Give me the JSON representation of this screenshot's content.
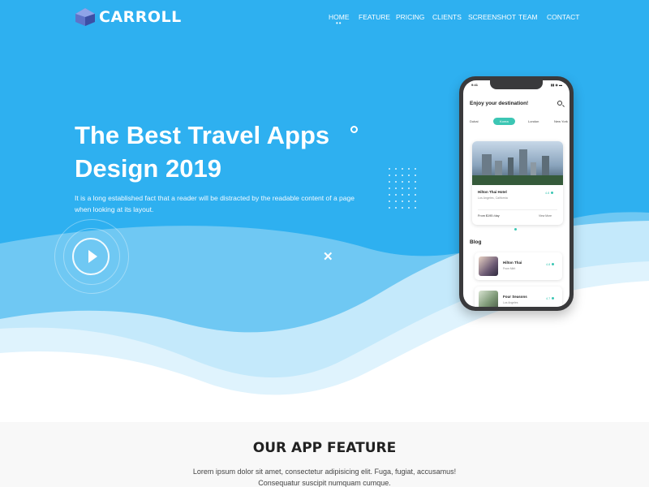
{
  "brand": {
    "name": "CARROLL",
    "accent": "#2eb0f0"
  },
  "nav": {
    "items": [
      {
        "label": "HOME"
      },
      {
        "label": "FEATURE"
      },
      {
        "label": "PRICING"
      },
      {
        "label": "CLIENTS"
      },
      {
        "label": "SCREENSHOT"
      },
      {
        "label": "TEAM"
      },
      {
        "label": "CONTACT"
      }
    ],
    "active": "HOME"
  },
  "hero": {
    "title_line1": "The Best Travel Apps",
    "title_line2": "Design 2019",
    "description": "It is a long established fact that a reader will be distracted by the readable content of a page when looking at its layout.",
    "play_icon": "play-icon",
    "close_icon": "close-icon"
  },
  "phone": {
    "time": "9:41",
    "title": "Enjoy your destination!",
    "cities": [
      "Dubai",
      "Korea",
      "London",
      "New York"
    ],
    "active_city": "Korea",
    "hotel": {
      "name": "Hilton Thai Hotel",
      "location": "Los Angeles, California",
      "rating": "4.8",
      "price": "From $195 /day",
      "more": "View More"
    },
    "blog_title": "Blog",
    "blogs": [
      {
        "name": "Hilton Thai",
        "sub": "From Mirit",
        "rating": "4.8"
      },
      {
        "name": "Four Seasons",
        "sub": "Los Angeles",
        "rating": "4.7"
      }
    ]
  },
  "feature": {
    "title": "OUR APP FEATURE",
    "description_line1": "Lorem ipsum dolor sit amet, consectetur adipisicing elit. Fuga, fugiat, accusamus!",
    "description_line2": "Consequatur suscipit numquam cumque."
  }
}
